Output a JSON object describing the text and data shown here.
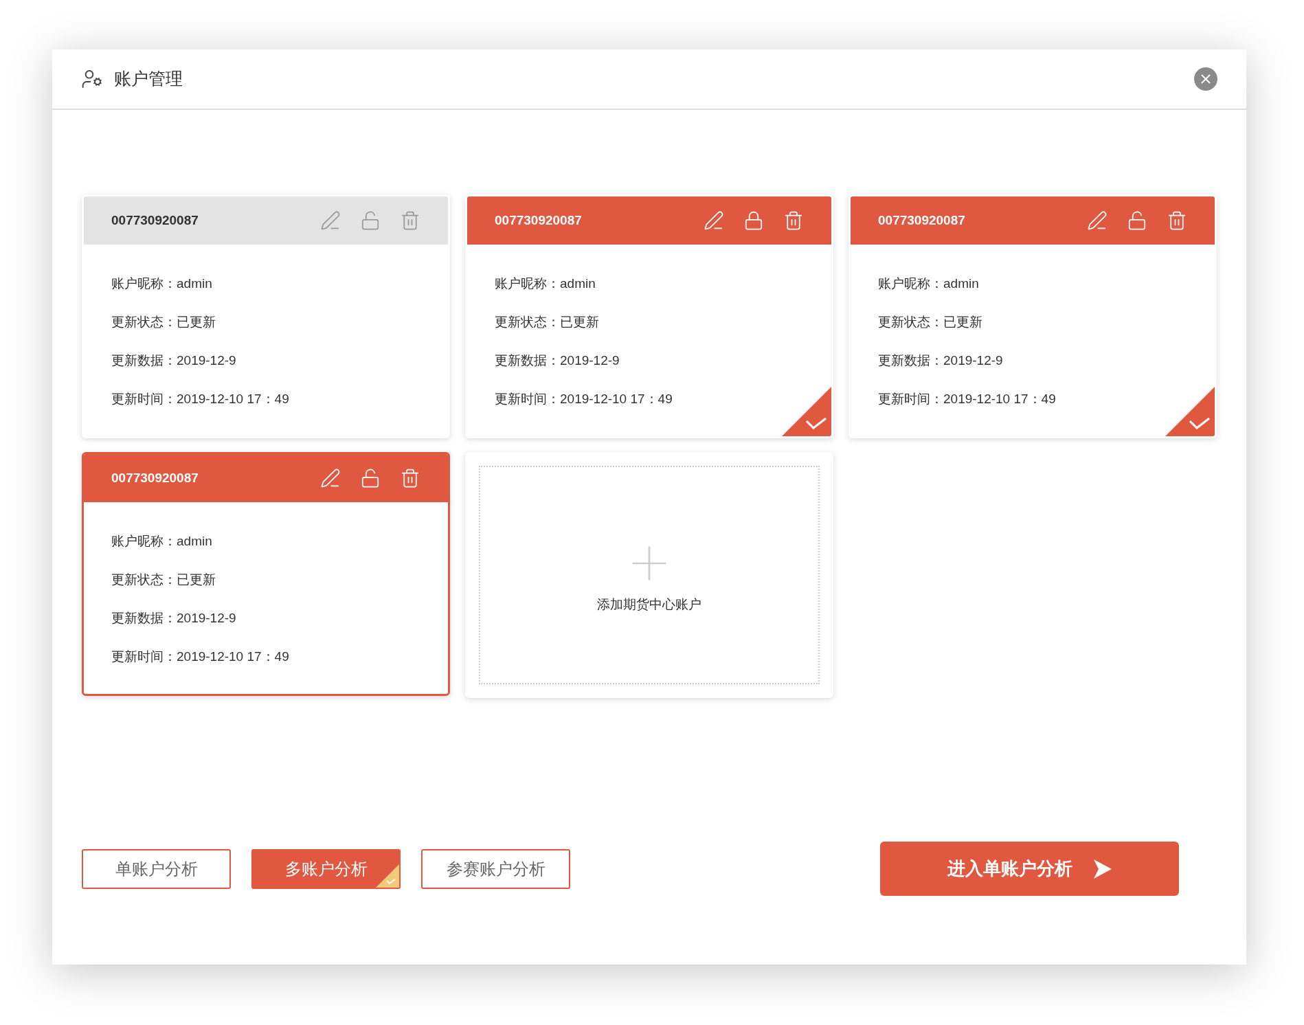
{
  "window": {
    "title": "账户管理"
  },
  "accounts": [
    {
      "number": "007730920087",
      "active": false,
      "locked": false,
      "checked": false,
      "focused": false,
      "fields": [
        {
          "label": "账户昵称：",
          "value": "admin"
        },
        {
          "label": "更新状态：",
          "value": "已更新"
        },
        {
          "label": "更新数据：",
          "value": "2019-12-9"
        },
        {
          "label": "更新时间：",
          "value": "2019-12-10 17：49"
        }
      ]
    },
    {
      "number": "007730920087",
      "active": true,
      "locked": true,
      "checked": true,
      "focused": false,
      "fields": [
        {
          "label": "账户昵称：",
          "value": "admin"
        },
        {
          "label": "更新状态：",
          "value": "已更新"
        },
        {
          "label": "更新数据：",
          "value": "2019-12-9"
        },
        {
          "label": "更新时间：",
          "value": "2019-12-10 17：49"
        }
      ]
    },
    {
      "number": "007730920087",
      "active": true,
      "locked": false,
      "checked": true,
      "focused": false,
      "fields": [
        {
          "label": "账户昵称：",
          "value": "admin"
        },
        {
          "label": "更新状态：",
          "value": "已更新"
        },
        {
          "label": "更新数据：",
          "value": "2019-12-9"
        },
        {
          "label": "更新时间：",
          "value": "2019-12-10 17：49"
        }
      ]
    },
    {
      "number": "007730920087",
      "active": true,
      "locked": false,
      "checked": false,
      "focused": true,
      "fields": [
        {
          "label": "账户昵称：",
          "value": "admin"
        },
        {
          "label": "更新状态：",
          "value": "已更新"
        },
        {
          "label": "更新数据：",
          "value": "2019-12-9"
        },
        {
          "label": "更新时间：",
          "value": "2019-12-10 17：49"
        }
      ]
    }
  ],
  "add_card": {
    "label": "添加期货中心账户"
  },
  "mode_tabs": [
    {
      "label": "单账户分析",
      "selected": false
    },
    {
      "label": "多账户分析",
      "selected": true
    },
    {
      "label": "参赛账户分析",
      "selected": false
    }
  ],
  "primary_button": {
    "label": "进入单账户分析"
  }
}
